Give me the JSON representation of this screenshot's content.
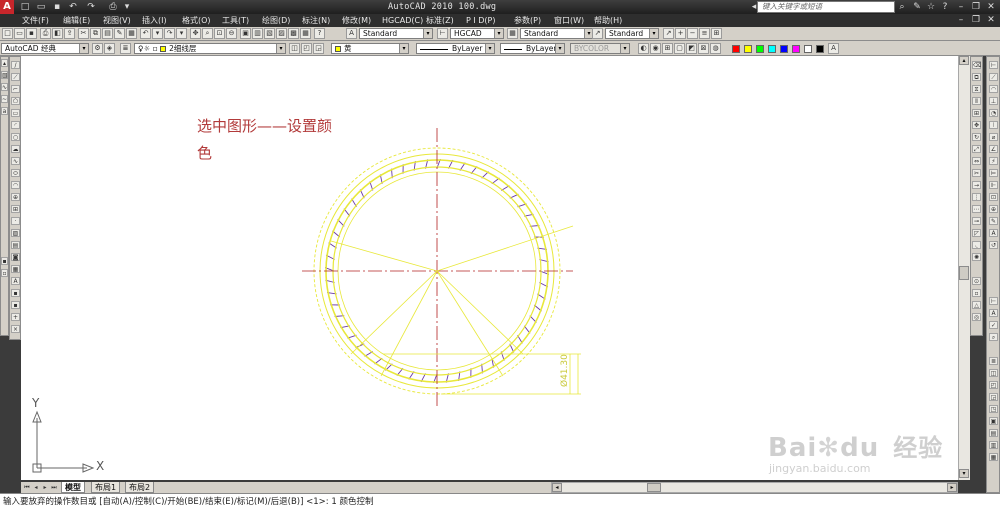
{
  "title_bar": {
    "logo": "A",
    "title": "AutoCAD 2010   100.dwg",
    "search_placeholder": "键入关键字或短语"
  },
  "menu": [
    "文件(F)",
    "编辑(E)",
    "视图(V)",
    "插入(I)",
    "格式(O)",
    "工具(T)",
    "绘图(D)",
    "标注(N)",
    "修改(M)",
    "HGCAD(C)",
    "标准(Z)",
    "P I D(P)",
    "参数(P)",
    "窗口(W)",
    "帮助(H)"
  ],
  "toolbar1": {
    "text_style": "Standard",
    "dim_style": "HGCAD",
    "table_style": "Standard",
    "multileader_style": "Standard"
  },
  "toolbar2": {
    "workspace": "AutoCAD 经典",
    "layer": "2细线层",
    "color": "黄",
    "linetype": "ByLayer",
    "lineweight": "ByLayer",
    "plot_style": "BYCOLOR"
  },
  "palette_colors": [
    "#ff0000",
    "#ffff00",
    "#00ff00",
    "#00ffff",
    "#0000ff",
    "#ff00ff",
    "#ffffff",
    "#000000"
  ],
  "canvas": {
    "annotation_line1": "选中图形——设置颜",
    "annotation_line2": "色",
    "dimension_text": "Ø41.30",
    "ucs_x": "X",
    "ucs_y": "Y"
  },
  "layout_tabs": [
    "模型",
    "布局1",
    "布局2"
  ],
  "command_line": "输入要放弃的操作数目或 [自动(A)/控制(C)/开始(BE)/结束(E)/标记(M)/后退(B)] <1>: 1 颜色控制",
  "watermark": {
    "brand": "Bai",
    "brand2": "du",
    "cn": "经验",
    "url": "jingyan.baidu.com"
  },
  "colors": {
    "drawing_yellow": "#e8e83a",
    "hatch_purple": "#6a3aa8",
    "annotation_red": "#b23a3a",
    "highlight_red": "#cc2222",
    "centerline_red": "#b22222"
  }
}
